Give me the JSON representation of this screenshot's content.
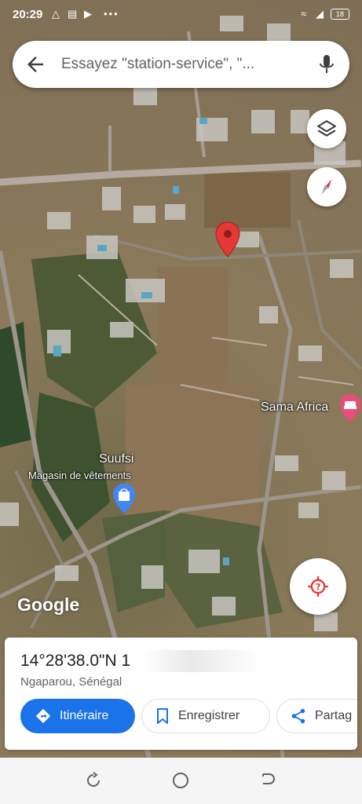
{
  "status_bar": {
    "time": "20:29",
    "battery": "18"
  },
  "search": {
    "placeholder": "Essayez \"station-service\", \"..."
  },
  "map": {
    "places": [
      {
        "name": "Sama Africa"
      },
      {
        "name": "Suufsi",
        "category": "Magasin de vêtements"
      }
    ],
    "attribution": "Google"
  },
  "place_card": {
    "coordinates": "14°28'38.0\"N 1",
    "locality": "Ngaparou, Sénégal",
    "actions": {
      "directions": "Itinéraire",
      "save": "Enregistrer",
      "share": "Partag"
    }
  },
  "colors": {
    "accent": "#1a73e8",
    "pin": "#e53935",
    "place_pink": "#e84c7b",
    "shop_blue": "#4285f4"
  },
  "icons": [
    "back-arrow-icon",
    "mic-icon",
    "layers-icon",
    "compass-icon",
    "pin-icon",
    "hotel-icon",
    "shopping-bag-icon",
    "my-location-icon",
    "directions-icon",
    "bookmark-icon",
    "share-icon",
    "recent-apps-icon",
    "home-icon",
    "back-icon"
  ]
}
